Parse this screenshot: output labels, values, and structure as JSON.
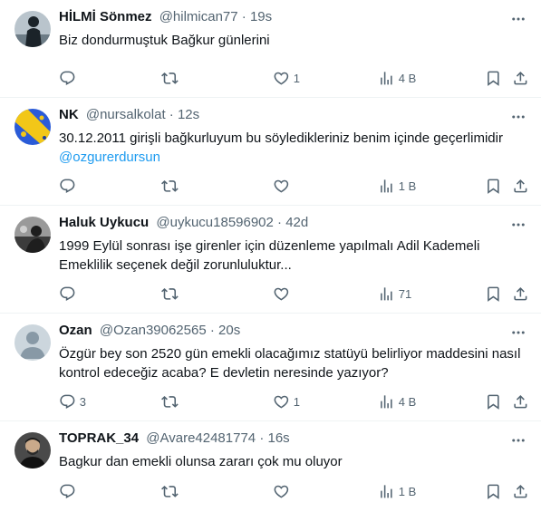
{
  "tweets": [
    {
      "name": "HİLMİ Sönmez",
      "handle": "@hilmican77",
      "dot": "·",
      "time": "19s",
      "avatar": "dark-figure-avatar",
      "text": "Biz dondurmuştuk Bağkur günlerini",
      "mention": "",
      "replies": "",
      "retweets": "",
      "likes": "1",
      "views": "4 B"
    },
    {
      "name": "NK",
      "handle": "@nursalkolat",
      "dot": "·",
      "time": "12s",
      "avatar": "blue-yellow-flag-avatar",
      "text": "30.12.2011 girişli bağkurluyum  bu söyledikleriniz benim içinde geçerlimidir",
      "mention": "@ozgurerdursun",
      "replies": "",
      "retweets": "",
      "likes": "",
      "views": "1 B"
    },
    {
      "name": "Haluk Uykucu",
      "handle": "@uykucu18596902",
      "dot": "·",
      "time": "42d",
      "avatar": "grayscale-photo-avatar",
      "text": "1999 Eylül sonrası işe girenler için düzenleme yapılmalı Adil Kademeli Emeklilik seçenek değil zorunluluktur...",
      "mention": "",
      "replies": "",
      "retweets": "",
      "likes": "",
      "views": "71"
    },
    {
      "name": "Ozan",
      "handle": "@Ozan39062565",
      "dot": "·",
      "time": "20s",
      "avatar": "default-profile-avatar",
      "text": "Özgür bey son 2520 gün emekli olacağımız statüyü belirliyor maddesini nasıl kontrol edeceğiz acaba? E devletin neresinde yazıyor?",
      "mention": "",
      "replies": "3",
      "retweets": "",
      "likes": "1",
      "views": "4 B"
    },
    {
      "name": "TOPRAK_34",
      "handle": "@Avare42481774",
      "dot": "·",
      "time": "16s",
      "avatar": "man-portrait-avatar",
      "text": "Bagkur dan emekli olunsa zararı çok mu oluyor",
      "mention": "",
      "replies": "",
      "retweets": "",
      "likes": "",
      "views": "1 B"
    }
  ],
  "colors": {
    "text": "#0f1419",
    "secondary": "#536471",
    "link": "#1d9bf0",
    "divider": "#eff3f4"
  }
}
